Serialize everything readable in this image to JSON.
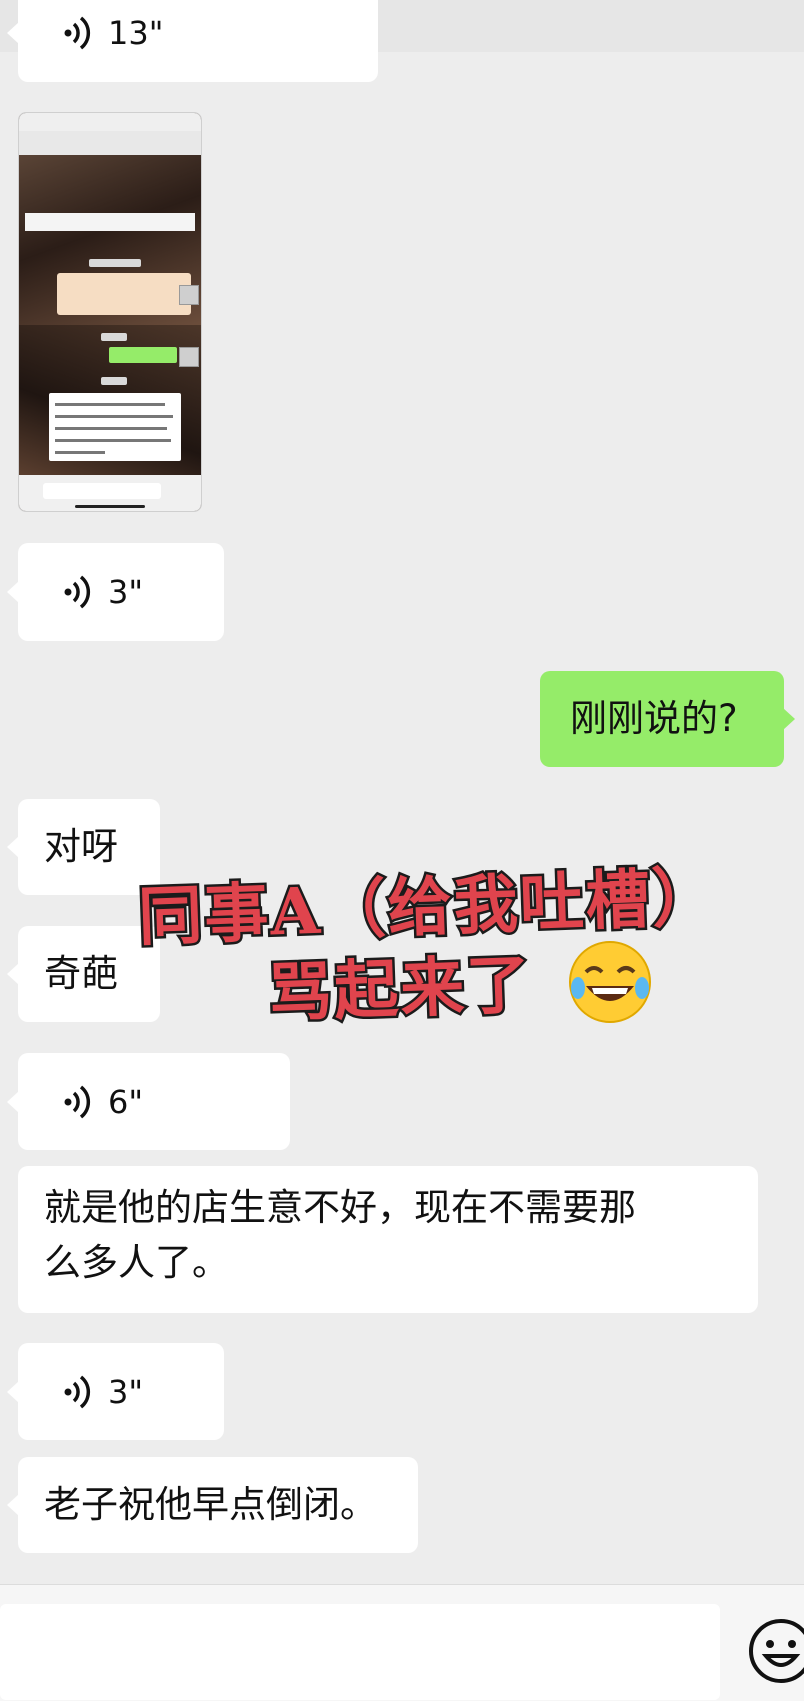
{
  "messages": {
    "voice1": {
      "duration": "13\""
    },
    "voice2": {
      "duration": "3\""
    },
    "sent1": {
      "text": "刚刚说的?"
    },
    "text1": {
      "text": "对呀"
    },
    "text2": {
      "text": "奇葩"
    },
    "voice3": {
      "duration": "6\""
    },
    "text3": {
      "line1": "就是他的店生意不好，现在不需要那",
      "line2": "么多人了。"
    },
    "voice4": {
      "duration": "3\""
    },
    "text4": {
      "text": "老子祝他早点倒闭。"
    }
  },
  "overlay": {
    "line1": "同事A（给我吐槽）",
    "line2": "骂起来了"
  },
  "icons": {
    "voice": "voice-wave-icon",
    "emoji_sticker": "laughing-tears-emoji",
    "emoji_button": "smiley-face-icon"
  },
  "colors": {
    "background": "#ededed",
    "received_bubble": "#ffffff",
    "sent_bubble": "#95ec69",
    "caption_fill": "#e0444d",
    "caption_stroke": "#1b1b1b"
  }
}
